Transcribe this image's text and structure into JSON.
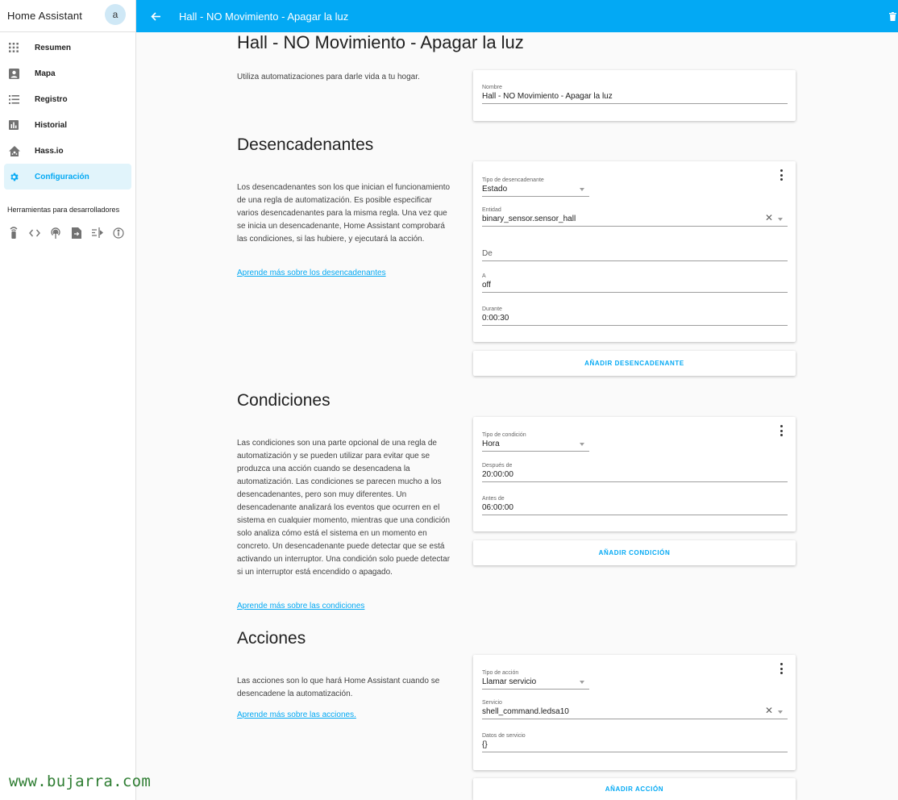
{
  "app": {
    "title": "Home Assistant",
    "avatar_letter": "a"
  },
  "sidebar": {
    "items": [
      {
        "label": "Resumen",
        "icon": "apps-grid-icon"
      },
      {
        "label": "Mapa",
        "icon": "account-box-icon"
      },
      {
        "label": "Registro",
        "icon": "format-list-icon"
      },
      {
        "label": "Historial",
        "icon": "chart-bar-icon"
      },
      {
        "label": "Hass.io",
        "icon": "home-assistant-icon"
      },
      {
        "label": "Configuración",
        "icon": "gear-icon",
        "active": true
      }
    ],
    "dev_tools_title": "Herramientas para desarrolladores",
    "dev_tools": [
      "remote-icon",
      "code-tags-icon",
      "radio-tower-icon",
      "file-export-icon",
      "timeline-icon",
      "info-icon"
    ]
  },
  "header": {
    "title": "Hall - NO Movimiento - Apagar la luz",
    "back_icon": "arrow-left-icon",
    "delete_icon": "trash-icon"
  },
  "page_title": "Hall - NO Movimiento - Apagar la luz",
  "intro": {
    "text": "Utiliza automatizaciones para darle vida a tu hogar.",
    "name_label": "Nombre",
    "name_value": "Hall - NO Movimiento - Apagar la luz"
  },
  "triggers": {
    "title": "Desencadenantes",
    "description": "Los desencadenantes son los que inician el funcionamiento de una regla de automatización. Es posible especificar varios desencadenantes para la misma regla. Una vez que se inicia un desencadenante, Home Assistant comprobará las condiciones, si las hubiere, y ejecutará la acción.",
    "learn_more": "Aprende más sobre los desencadenantes",
    "type_label": "Tipo de desencadenante",
    "type_value": "Estado",
    "entity_label": "Entidad",
    "entity_value": "binary_sensor.sensor_hall",
    "from_placeholder": "De",
    "to_label": "A",
    "to_value": "off",
    "for_label": "Durante",
    "for_value": "0:00:30",
    "add_button": "AÑADIR DESENCADENANTE"
  },
  "conditions": {
    "title": "Condiciones",
    "description": "Las condiciones son una parte opcional de una regla de automatización y se pueden utilizar para evitar que se produzca una acción cuando se desencadena la automatización. Las condiciones se parecen mucho a los desencadenantes, pero son muy diferentes. Un desencadenante analizará los eventos que ocurren en el sistema en cualquier momento, mientras que una condición solo analiza cómo está el sistema en un momento en concreto. Un desencadenante puede detectar que se está activando un interruptor. Una condición solo puede detectar si un interruptor está encendido o apagado.",
    "learn_more": "Aprende más sobre las condiciones",
    "type_label": "Tipo de condición",
    "type_value": "Hora",
    "after_label": "Después de",
    "after_value": "20:00:00",
    "before_label": "Antes de",
    "before_value": "06:00:00",
    "add_button": "AÑADIR CONDICIÓN"
  },
  "actions": {
    "title": "Acciones",
    "description": "Las acciones son lo que hará Home Assistant cuando se desencadene la automatización.",
    "learn_more": "Aprende más sobre las acciones.",
    "type_label": "Tipo de acción",
    "type_value": "Llamar servicio",
    "service_label": "Servicio",
    "service_value": "shell_command.ledsa10",
    "data_label": "Datos de servicio",
    "data_value": "{}",
    "add_button": "AÑADIR ACCIÓN"
  },
  "watermark": "www.bujarra.com",
  "colors": {
    "primary": "#03a9f4",
    "active_bg": "#e1f4fb",
    "watermark": "#2e7d32"
  }
}
